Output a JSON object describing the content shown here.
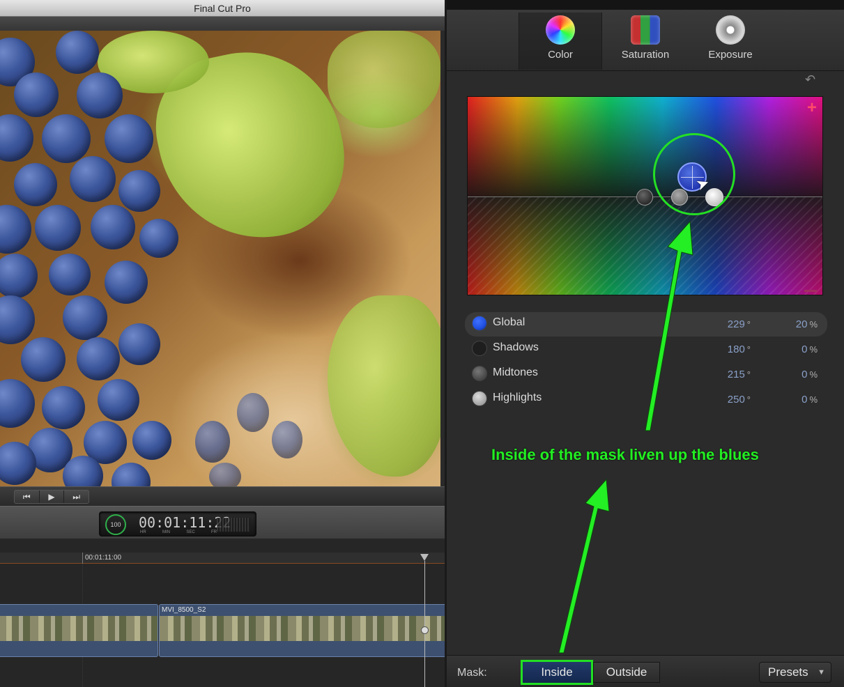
{
  "window": {
    "title": "Final Cut Pro"
  },
  "transport": {
    "prev_label": "⏮",
    "play_label": "▶",
    "next_label": "⏭"
  },
  "timecode": {
    "zoom_value": "100",
    "value": "00:01:11:22",
    "units": [
      "HR",
      "MIN",
      "SEC",
      "FR"
    ]
  },
  "timeline": {
    "ruler_label": "00:01:11:00",
    "clips": [
      {
        "name": ""
      },
      {
        "name": "MVI_8500_S2"
      }
    ]
  },
  "inspector": {
    "tabs": [
      {
        "label": "Color",
        "icon": "color-wheel-icon",
        "active": true
      },
      {
        "label": "Saturation",
        "icon": "saturation-icon",
        "active": false
      },
      {
        "label": "Exposure",
        "icon": "exposure-icon",
        "active": false
      }
    ],
    "board": {
      "plus_symbol": "+"
    },
    "controls": [
      {
        "name": "Global",
        "hue": "229",
        "hue_unit": "°",
        "sat": "20",
        "sat_unit": "%",
        "color": "#1f4fe0",
        "selected": true
      },
      {
        "name": "Shadows",
        "hue": "180",
        "hue_unit": "°",
        "sat": "0",
        "sat_unit": "%",
        "color": "#1e1e1e",
        "selected": false
      },
      {
        "name": "Midtones",
        "hue": "215",
        "hue_unit": "°",
        "sat": "0",
        "sat_unit": "%",
        "color": "#444444",
        "selected": false
      },
      {
        "name": "Highlights",
        "hue": "250",
        "hue_unit": "°",
        "sat": "0",
        "sat_unit": "%",
        "color": "#9a9a9a",
        "selected": false
      }
    ],
    "annotation": "Inside of the mask liven up the blues",
    "mask": {
      "label": "Mask:",
      "inside_label": "Inside",
      "outside_label": "Outside",
      "presets_label": "Presets",
      "presets_arrow": "▼"
    }
  },
  "colors": {
    "annotation_green": "#22ee22",
    "accent_blue": "#1f4fe0"
  }
}
